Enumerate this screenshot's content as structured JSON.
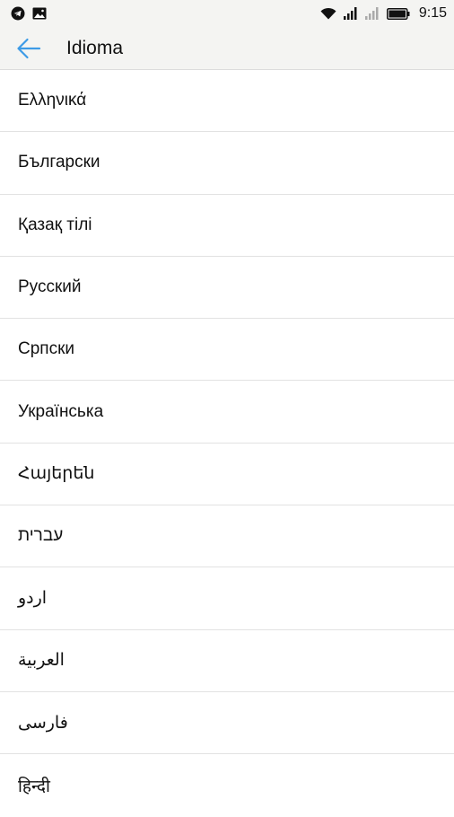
{
  "status_bar": {
    "left_icons": [
      "telegram-icon",
      "image-icon"
    ],
    "right_icons": [
      "wifi-icon",
      "signal-icon",
      "signal-empty-icon",
      "battery-icon"
    ],
    "time": "9:15"
  },
  "app_bar": {
    "back_icon": "arrow-left-icon",
    "title": "Idioma",
    "accent_color": "#3d9be6"
  },
  "languages": [
    {
      "label": "Ελληνικά",
      "rtl": false
    },
    {
      "label": "Български",
      "rtl": false
    },
    {
      "label": "Қазақ тілі",
      "rtl": false
    },
    {
      "label": "Русский",
      "rtl": false
    },
    {
      "label": "Српски",
      "rtl": false
    },
    {
      "label": "Українська",
      "rtl": false
    },
    {
      "label": "Հայերեն",
      "rtl": false
    },
    {
      "label": "עברית",
      "rtl": true
    },
    {
      "label": "اردو",
      "rtl": true
    },
    {
      "label": "العربية",
      "rtl": true
    },
    {
      "label": "فارسی",
      "rtl": true
    },
    {
      "label": "हिन्दी",
      "rtl": false
    }
  ]
}
